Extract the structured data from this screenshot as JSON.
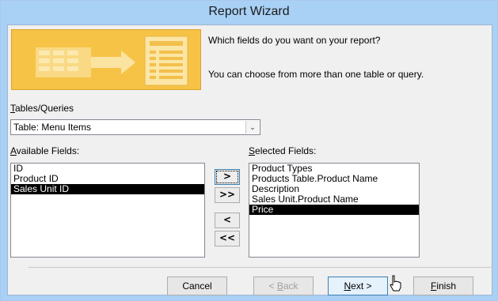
{
  "window": {
    "title": "Report Wizard"
  },
  "prompts": {
    "question": "Which fields do you want on your report?",
    "hint": "You can choose from more than one table or query."
  },
  "tables_queries": {
    "label_prefix": "T",
    "label_rest": "ables/Queries",
    "selected": "Table: Menu Items"
  },
  "available": {
    "label_prefix": "A",
    "label_rest": "vailable Fields:",
    "items": [
      "ID",
      "Product ID",
      "Sales Unit ID"
    ],
    "selected_index": 2
  },
  "selected_fields": {
    "label_prefix": "S",
    "label_rest": "elected Fields:",
    "items": [
      "Product Types",
      "Products Table.Product Name",
      "Description",
      "Sales Unit.Product Name",
      "Price"
    ],
    "selected_index": 4
  },
  "move_buttons": {
    "add_one": ">",
    "add_all": ">>",
    "remove_one": "<",
    "remove_all": "<<"
  },
  "buttons": {
    "cancel": "Cancel",
    "back_prefix": "< ",
    "back_u": "B",
    "back_rest": "ack",
    "next_u": "N",
    "next_rest": "ext >",
    "finish_u": "F",
    "finish_rest": "inish"
  },
  "colors": {
    "title_bar": "#a9d0f5",
    "banner": "#f7c64a",
    "selection": "#000000"
  }
}
